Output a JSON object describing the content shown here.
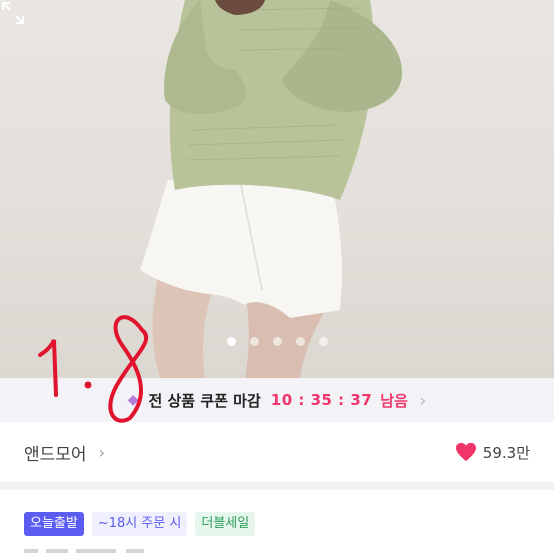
{
  "hero": {
    "image_description_icon": "product-photo",
    "carousel": {
      "count": 5,
      "active_index": 0
    }
  },
  "coupon": {
    "icon": "coupon-icon",
    "text": "전 상품 쿠폰 마감",
    "timer": "10 : 35 : 37",
    "remain_label": "남음",
    "chevron": "›"
  },
  "annotation": {
    "text": "1.8"
  },
  "brand": {
    "name": "앤드모어",
    "chevron": "›",
    "like_count": "59.3만"
  },
  "tags": [
    {
      "label": "오늘출발"
    },
    {
      "label": "~18시 주문 시"
    },
    {
      "label": "더블세일"
    }
  ],
  "colors": {
    "accent_pink": "#f0356a",
    "tag_blue": "#5b5cf0",
    "tag_green": "#2f9e5a",
    "annotation_red": "#e0142c"
  }
}
